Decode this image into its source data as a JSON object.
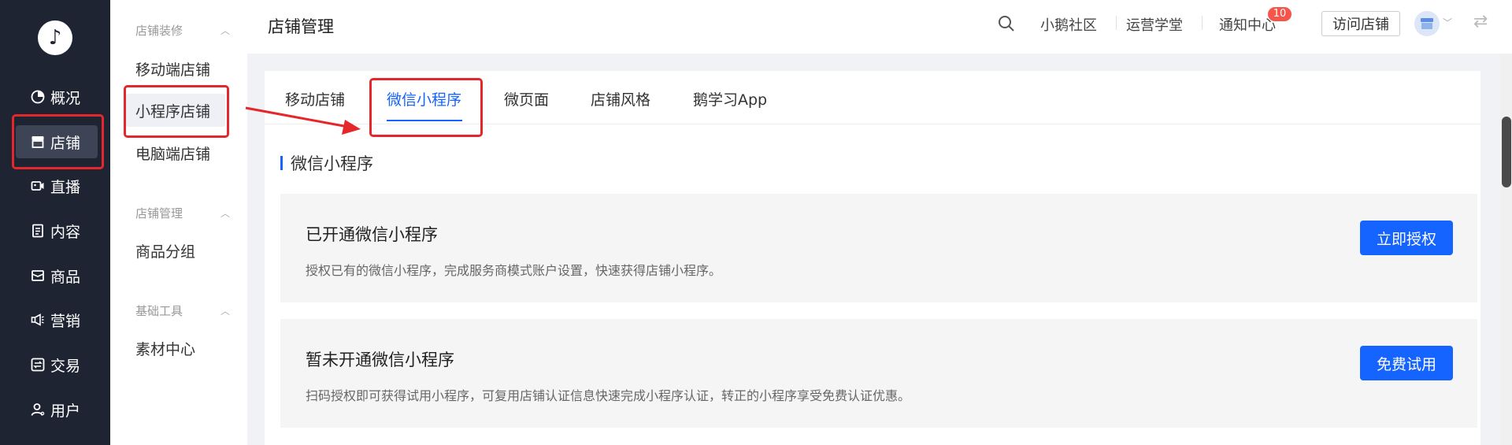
{
  "rail": {
    "logo": "♪",
    "items": [
      {
        "label": "概况",
        "icon": "pie-chart-icon"
      },
      {
        "label": "店铺",
        "icon": "store-icon"
      },
      {
        "label": "直播",
        "icon": "camera-icon"
      },
      {
        "label": "内容",
        "icon": "document-icon"
      },
      {
        "label": "商品",
        "icon": "box-icon"
      },
      {
        "label": "营销",
        "icon": "megaphone-icon"
      },
      {
        "label": "交易",
        "icon": "exchange-icon"
      },
      {
        "label": "用户",
        "icon": "user-icon"
      }
    ],
    "active_index": 1
  },
  "side": {
    "groups": [
      {
        "label": "店铺装修",
        "items": [
          "移动端店铺",
          "小程序店铺",
          "电脑端店铺"
        ]
      },
      {
        "label": "店铺管理",
        "items": [
          "商品分组"
        ]
      },
      {
        "label": "基础工具",
        "items": [
          "素材中心"
        ]
      }
    ],
    "active_item": "小程序店铺"
  },
  "header": {
    "title": "店铺管理",
    "links": [
      "小鹅社区",
      "运营学堂",
      "通知中心"
    ],
    "notify_count": "10",
    "visit_label": "访问店铺"
  },
  "tabs": [
    {
      "label": "移动店铺"
    },
    {
      "label": "微信小程序"
    },
    {
      "label": "微页面"
    },
    {
      "label": "店铺风格"
    },
    {
      "label": "鹅学习App"
    }
  ],
  "active_tab": 1,
  "section": {
    "title": "微信小程序"
  },
  "panels": [
    {
      "heading": "已开通微信小程序",
      "desc": "授权已有的微信小程序，完成服务商模式账户设置，快速获得店铺小程序。",
      "button": "立即授权"
    },
    {
      "heading": "暂未开通微信小程序",
      "desc": "扫码授权即可获得试用小程序，可复用店铺认证信息快速完成小程序认证，转正的小程序享受免费认证优惠。",
      "button": "免费试用"
    }
  ],
  "colors": {
    "accent": "#1664ff",
    "rail_bg": "#1f2433",
    "annotation": "#e5262a",
    "badge": "#f5554a"
  }
}
